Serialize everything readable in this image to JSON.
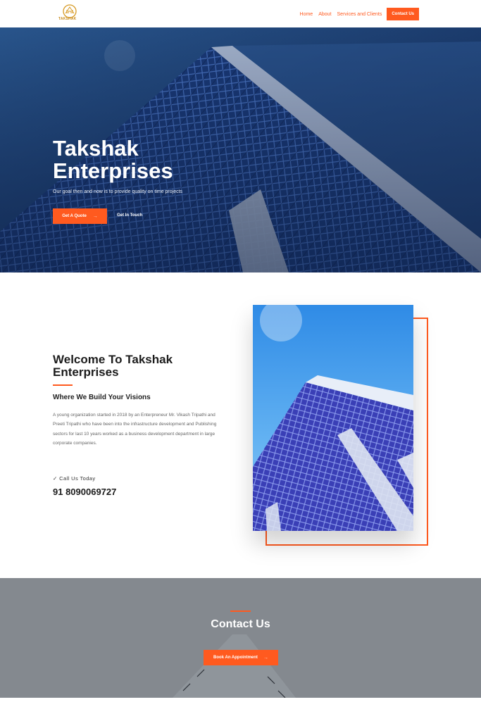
{
  "brand": {
    "logo_text": "TAKSHAK"
  },
  "nav": {
    "items": [
      "Home",
      "About",
      "Services and Clients"
    ],
    "cta": "Contact Us"
  },
  "hero": {
    "title_line1": "Takshak",
    "title_line2": "Enterprises",
    "subtitle": "Our goal then and now is to provide quality on time projects",
    "quote_button": "Get A Quote",
    "quote_arrow": "→",
    "touch_link": "Get In Touch"
  },
  "welcome": {
    "title_line1": "Welcome To Takshak",
    "title_line2": "Enterprises",
    "subtitle": "Where We Build Your Visions",
    "body": "A young organization started in 2018 by an Enterpreneur Mr. Vikash Tripathi and Preeti Tripathi who have been into the infrastructure development and Publishing sectors for last 10 years worked as a business development department in large corporate companies.",
    "call_icon": "✓",
    "call_label": "Call Us Today",
    "phone": "91 8090069727"
  },
  "contact": {
    "title": "Contact Us",
    "button": "Book An Appointment",
    "button_arrow": "→"
  },
  "colors": {
    "accent": "#ff5a1f",
    "hero_bg": "#1b3a66",
    "band_bg": "#84898f"
  }
}
